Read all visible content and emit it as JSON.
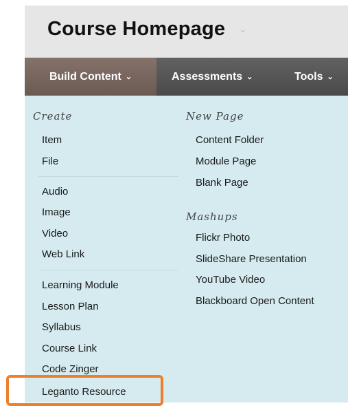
{
  "header": {
    "title": "Course Homepage",
    "title_chevron": "⌄"
  },
  "menu_bar": {
    "tabs": [
      {
        "label": "Build Content",
        "chevron": "⌄",
        "active": true
      },
      {
        "label": "Assessments",
        "chevron": "⌄",
        "active": false
      },
      {
        "label": "Tools",
        "chevron": "⌄",
        "active": false
      }
    ]
  },
  "dropdown": {
    "left_column": {
      "heading": "Create",
      "items": [
        "Item",
        "File",
        "Audio",
        "Image",
        "Video",
        "Web Link",
        "Learning Module",
        "Lesson Plan",
        "Syllabus",
        "Course Link",
        "Code Zinger",
        "Leganto Resource"
      ]
    },
    "right_column": {
      "new_page_heading": "New Page",
      "new_page_items": [
        "Content Folder",
        "Module Page",
        "Blank Page"
      ],
      "mashups_heading": "Mashups",
      "mashups_items": [
        "Flickr Photo",
        "SlideShare Presentation",
        "YouTube Video",
        "Blackboard Open Content"
      ]
    }
  },
  "colors": {
    "dropdown_bg": "#d5ebef",
    "menu_bar_bg": "#585858",
    "active_tab_bg": "#7a685f",
    "highlight_border": "#ee7f2d"
  }
}
